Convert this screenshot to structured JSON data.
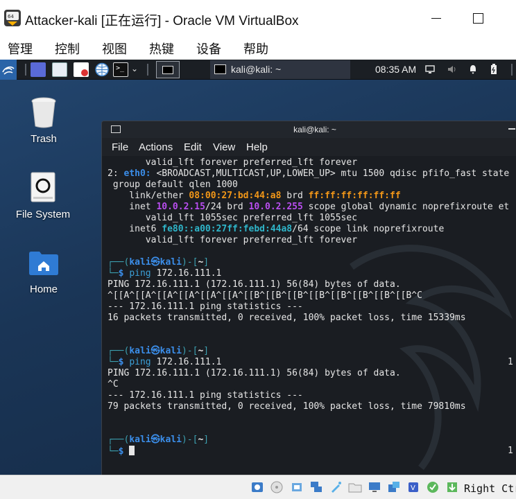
{
  "host": {
    "title": "Attacker-kali [正在运行] - Oracle VM VirtualBox",
    "menu": [
      "管理",
      "控制",
      "视图",
      "热键",
      "设备",
      "帮助"
    ],
    "host_key": "Right Ctrl"
  },
  "panel": {
    "task_label": "kali@kali: ~",
    "clock": "08:35 AM"
  },
  "desktop": {
    "icons": [
      {
        "label": "Trash",
        "icon": "trash-icon"
      },
      {
        "label": "File System",
        "icon": "drive-icon"
      },
      {
        "label": "Home",
        "icon": "home-folder-icon"
      }
    ]
  },
  "terminal": {
    "title": "kali@kali: ~",
    "menu": [
      "File",
      "Actions",
      "Edit",
      "View",
      "Help"
    ],
    "lines": {
      "l1": "       valid_lft forever preferred_lft forever",
      "l2_pre": "2: ",
      "l2_iface": "eth0:",
      "l2_post": " <BROADCAST,MULTICAST,UP,LOWER_UP> mtu 1500 qdisc pfifo_fast state",
      "l3": " group default qlen 1000",
      "l4_pre": "    link/ether ",
      "l4_mac": "08:00:27:bd:44:a8",
      "l4_mid": " brd ",
      "l4_brd": "ff:ff:ff:ff:ff:ff",
      "l5_pre": "    inet ",
      "l5_ip": "10.0.2.15",
      "l5_mid": "/24 brd ",
      "l5_brd": "10.0.2.255",
      "l5_post": " scope global dynamic noprefixroute et",
      "l6": "       valid_lft 1055sec preferred_lft 1055sec",
      "l7_pre": "    inet6 ",
      "l7_ip": "fe80::a00:27ff:febd:44a8",
      "l7_post": "/64 scope link noprefixroute",
      "l8": "       valid_lft forever preferred_lft forever",
      "p_user": "kali",
      "p_at": "㉿",
      "p_host": "kali",
      "p_dir": "~",
      "cmd1": "ping",
      "cmd1_args": " 172.16.111.1",
      "out1": "PING 172.16.111.1 (172.16.111.1) 56(84) bytes of data.",
      "out2": "^[[A^[[A^[[A^[[A^[[A^[[A^[[B^[[B^[[B^[[B^[[B^[[B^[[B^[[B^C",
      "out3": "--- 172.16.111.1 ping statistics ---",
      "out4": "16 packets transmitted, 0 received, 100% packet loss, time 15339ms",
      "out5": "PING 172.16.111.1 (172.16.111.1) 56(84) bytes of data.",
      "out6": "^C",
      "out7": "--- 172.16.111.1 ping statistics ---",
      "out8": "79 packets transmitted, 0 received, 100% packet loss, time 79810ms",
      "edge": "1"
    }
  }
}
